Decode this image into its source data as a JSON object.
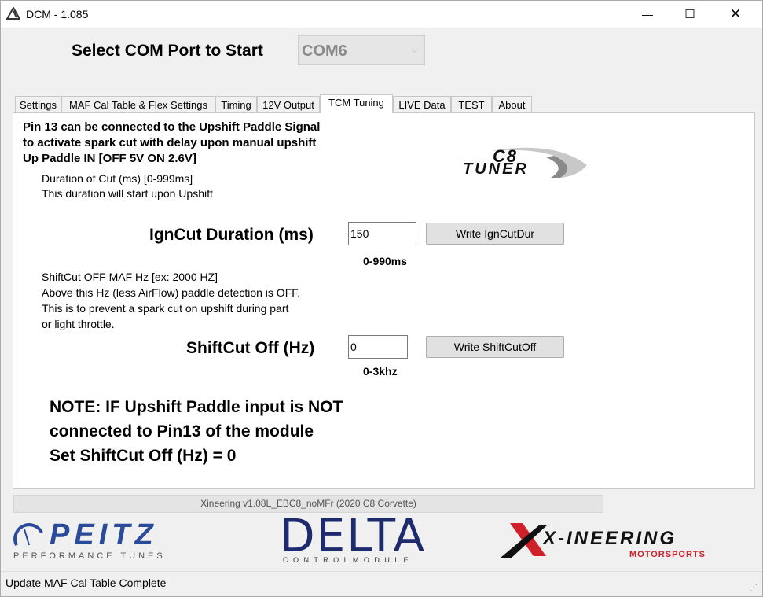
{
  "window": {
    "title": "DCM - 1.085",
    "minimize_glyph": "—",
    "maximize_glyph": "☐",
    "close_glyph": "✕"
  },
  "com": {
    "label": "Select COM Port to Start",
    "selected": "COM6",
    "arrow": "⌵"
  },
  "tabs": [
    {
      "label": "Settings"
    },
    {
      "label": "MAF Cal Table & Flex Settings"
    },
    {
      "label": "Timing"
    },
    {
      "label": "12V Output"
    },
    {
      "label": "TCM Tuning",
      "active": true
    },
    {
      "label": "LIVE Data"
    },
    {
      "label": "TEST"
    },
    {
      "label": "About"
    }
  ],
  "panel": {
    "intro_line1": "Pin 13 can be connected to the Upshift Paddle Signal",
    "intro_line2": "to activate spark cut with delay upon manual upshift",
    "intro_line3": "Up Paddle IN [OFF 5V ON 2.6V]",
    "dur_line1": "Duration of Cut (ms) [0-999ms]",
    "dur_line2": "This duration will start upon Upshift",
    "ign_label": "IgnCut Duration (ms)",
    "ign_value": "150",
    "ign_button": "Write IgnCutDur",
    "ign_range": "0-990ms",
    "shift_line1": "ShiftCut OFF MAF Hz [ex: 2000 HZ]",
    "shift_line2": "Above this Hz (less AirFlow) paddle detection is OFF.",
    "shift_line3": "This is to prevent a spark cut on upshift during part",
    "shift_line4": "or light throttle.",
    "shift_label": "ShiftCut Off (Hz)",
    "shift_value": "0",
    "shift_button": "Write ShiftCutOff",
    "shift_range": "0-3khz",
    "note_line1": "NOTE:  IF Upshift Paddle input is NOT",
    "note_line2": "connected to Pin13 of the module",
    "note_line3": "Set ShiftCut Off (Hz) = 0",
    "logo_c8_top": "C8",
    "logo_c8_bottom": "TUNER"
  },
  "version": "Xineering v1.08L_EBC8_noMFr (2020 C8 Corvette)",
  "logos": {
    "peitz_main": "PEITZ",
    "peitz_sub": "PERFORMANCE TUNES",
    "delta_main": "DELTA",
    "delta_sub": "C O N T R O L   M O D U L E",
    "xin_main": "X-INEERING",
    "xin_sub": "MOTORSPORTS"
  },
  "status": "Update MAF Cal Table Complete",
  "colors": {
    "peitz_blue": "#2a4a9a",
    "delta_navy": "#1e2a6e",
    "xin_red": "#d0202a",
    "panel_bg": "#ffffff",
    "window_bg": "#f0f0f0"
  }
}
